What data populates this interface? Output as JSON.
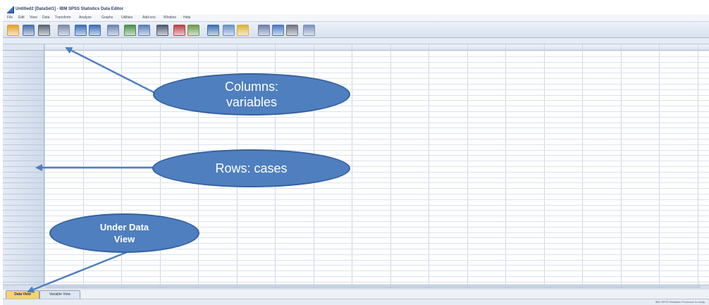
{
  "window": {
    "title": "Untitled2 [DataSet1] - IBM SPSS Statistics Data Editor"
  },
  "menu": [
    "File",
    "Edit",
    "View",
    "Data",
    "Transform",
    "Analyze",
    "Graphs",
    "Utilities",
    "Add-ons",
    "Window",
    "Help"
  ],
  "toolbar_icons": [
    {
      "name": "open-icon",
      "color": "#e0a22a"
    },
    {
      "name": "save-icon",
      "color": "#4b6ea8"
    },
    {
      "name": "print-icon",
      "color": "#5b6573"
    },
    {
      "name": "dialog-recall-icon",
      "color": "#7a8aa8"
    },
    {
      "name": "undo-icon",
      "color": "#3a6fb6"
    },
    {
      "name": "redo-icon",
      "color": "#3a6fb6"
    },
    {
      "name": "goto-case-icon",
      "color": "#6c84ad"
    },
    {
      "name": "goto-variable-icon",
      "color": "#4a8f4a"
    },
    {
      "name": "variables-icon",
      "color": "#5b7fb5"
    },
    {
      "name": "find-icon",
      "color": "#4d5a6e"
    },
    {
      "name": "insert-cases-icon",
      "color": "#b8434a"
    },
    {
      "name": "insert-variable-icon",
      "color": "#6a9a4a"
    },
    {
      "name": "split-file-icon",
      "color": "#3c6fb2"
    },
    {
      "name": "weight-cases-icon",
      "color": "#6b8fc5"
    },
    {
      "name": "select-cases-icon",
      "color": "#d9b43a"
    },
    {
      "name": "value-labels-icon",
      "color": "#6f7fa8"
    },
    {
      "name": "use-sets-icon",
      "color": "#4d79c0"
    },
    {
      "name": "show-all-icon",
      "color": "#6d7380"
    },
    {
      "name": "spelling-icon",
      "color": "#7d93b8"
    }
  ],
  "tabs": {
    "data_view": "Data View",
    "variable_view": "Variable View"
  },
  "status": {
    "text": "IBM SPSS Statistics Processor is ready"
  },
  "callouts": {
    "columns": "Columns:\nvariables",
    "rows": "Rows: cases",
    "under": "Under Data\nView"
  },
  "colors": {
    "callout_fill": "#4f7fbf",
    "arrow": "#4f7fbf",
    "active_tab": "#f6d46a"
  }
}
